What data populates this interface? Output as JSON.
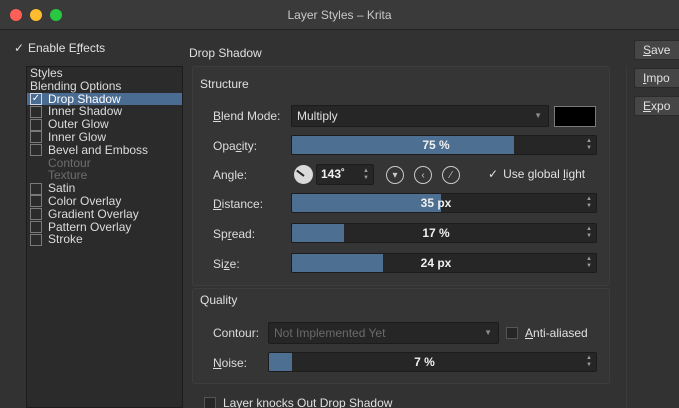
{
  "window": {
    "title": "Layer Styles – Krita"
  },
  "enable_effects": {
    "label": "Enable Effects",
    "checked": true
  },
  "styles_list": {
    "items": [
      {
        "label": "Styles",
        "checkbox": false,
        "enabled": true
      },
      {
        "label": "Blending Options",
        "checkbox": false,
        "enabled": true
      },
      {
        "label": "Drop Shadow",
        "checkbox": true,
        "checked": true,
        "selected": true,
        "enabled": true
      },
      {
        "label": "Inner Shadow",
        "checkbox": true,
        "checked": false,
        "enabled": true
      },
      {
        "label": "Outer Glow",
        "checkbox": true,
        "checked": false,
        "enabled": true
      },
      {
        "label": "Inner Glow",
        "checkbox": true,
        "checked": false,
        "enabled": true
      },
      {
        "label": "Bevel and Emboss",
        "checkbox": true,
        "checked": false,
        "enabled": true
      },
      {
        "label": "Contour",
        "checkbox": false,
        "enabled": false
      },
      {
        "label": "Texture",
        "checkbox": false,
        "enabled": false
      },
      {
        "label": "Satin",
        "checkbox": true,
        "checked": false,
        "enabled": true
      },
      {
        "label": "Color Overlay",
        "checkbox": true,
        "checked": false,
        "enabled": true
      },
      {
        "label": "Gradient Overlay",
        "checkbox": true,
        "checked": false,
        "enabled": true
      },
      {
        "label": "Pattern Overlay",
        "checkbox": true,
        "checked": false,
        "enabled": true
      },
      {
        "label": "Stroke",
        "checkbox": true,
        "checked": false,
        "enabled": true
      }
    ]
  },
  "panel": {
    "title": "Drop Shadow",
    "structure": {
      "title": "Structure",
      "blend_mode": {
        "label": "Blend Mode:",
        "value": "Multiply",
        "color": "#000000"
      },
      "opacity": {
        "label": "Opacity:",
        "value": 75,
        "display": "75 %"
      },
      "angle": {
        "label": "Angle:",
        "degrees": 143,
        "display": "143˚",
        "use_global_light": {
          "label": "Use global light",
          "checked": true
        }
      },
      "distance": {
        "label": "Distance:",
        "fraction": 0.49,
        "display": "35 px"
      },
      "spread": {
        "label": "Spread:",
        "value": 17,
        "display": "17 %"
      },
      "size": {
        "label": "Size:",
        "fraction": 0.3,
        "display": "24 px"
      }
    },
    "quality": {
      "title": "Quality",
      "contour": {
        "label": "Contour:",
        "value": "Not Implemented Yet"
      },
      "anti_aliased": {
        "label": "Anti-aliased",
        "checked": false
      },
      "noise": {
        "label": "Noise:",
        "value": 7,
        "display": "7 %"
      }
    },
    "layer_knocks_out": {
      "label": "Layer knocks Out Drop Shadow",
      "checked": false
    }
  },
  "buttons": {
    "save": "Save",
    "import": "Impo",
    "export": "Expo"
  },
  "colors": {
    "accent": "#4d6f92",
    "selection": "#4a6c92",
    "background": "#323232"
  }
}
